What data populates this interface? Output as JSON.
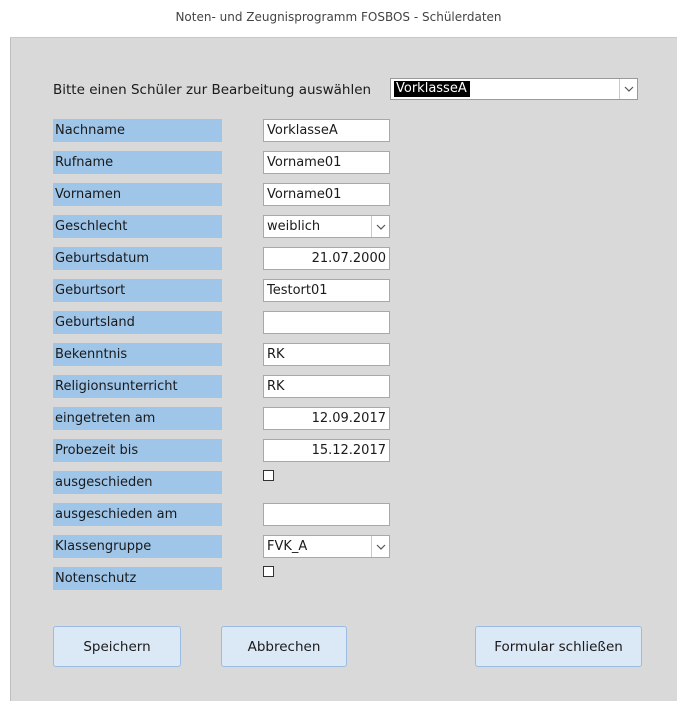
{
  "window": {
    "title": "Noten- und Zeugnisprogramm FOSBOS - Schülerdaten"
  },
  "selector": {
    "prompt": "Bitte einen Schüler zur Bearbeitung auswählen",
    "value": "VorklasseA"
  },
  "fields": [
    {
      "label": "Nachname",
      "value": "VorklasseA"
    },
    {
      "label": "Rufname",
      "value": "Vorname01"
    },
    {
      "label": "Vornamen",
      "value": "Vorname01"
    },
    {
      "label": "Geschlecht",
      "value": "weiblich"
    },
    {
      "label": "Geburtsdatum",
      "value": "21.07.2000"
    },
    {
      "label": "Geburtsort",
      "value": "Testort01"
    },
    {
      "label": "Geburtsland",
      "value": ""
    },
    {
      "label": "Bekenntnis",
      "value": "RK"
    },
    {
      "label": "Religionsunterricht",
      "value": "RK"
    },
    {
      "label": "eingetreten am",
      "value": "12.09.2017"
    },
    {
      "label": "Probezeit bis",
      "value": "15.12.2017"
    },
    {
      "label": "ausgeschieden",
      "checked": false
    },
    {
      "label": "ausgeschieden am",
      "value": ""
    },
    {
      "label": "Klassengruppe",
      "value": "FVK_A"
    },
    {
      "label": "Notenschutz",
      "checked": false
    }
  ],
  "buttons": {
    "save": "Speichern",
    "cancel": "Abbrechen",
    "close": "Formular schließen"
  },
  "icons": {
    "dropdown": "chevron-down-icon"
  }
}
